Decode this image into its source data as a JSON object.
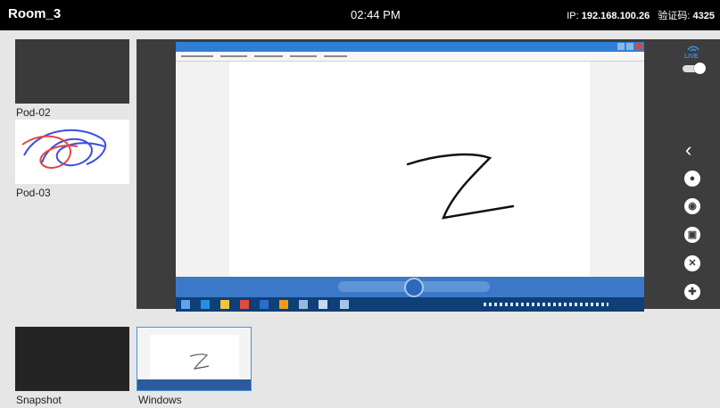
{
  "header": {
    "room": "Room_3",
    "time": "02:44 PM",
    "ip_label": "IP:",
    "ip_value": "192.168.100.26",
    "code_label": "验证码:",
    "code_value": "4325"
  },
  "pods": [
    {
      "label": "Pod-02"
    },
    {
      "label": "Pod-03"
    }
  ],
  "bottom": {
    "snapshot_label": "Snapshot",
    "windows_label": "Windows"
  },
  "side_toolbar": {
    "live_label": "LIVE",
    "live_on": true,
    "icons": [
      "live-icon",
      "collapse-chevron-icon",
      "user-icon",
      "camera-icon",
      "screenshot-icon",
      "trash-icon",
      "lifebuoy-icon"
    ]
  },
  "colors": {
    "topbar": "#000000",
    "stage": "#3d3d3d",
    "accent": "#2f7fd6",
    "pen_red": "#e2463c",
    "pen_blue": "#3c4ee0"
  }
}
